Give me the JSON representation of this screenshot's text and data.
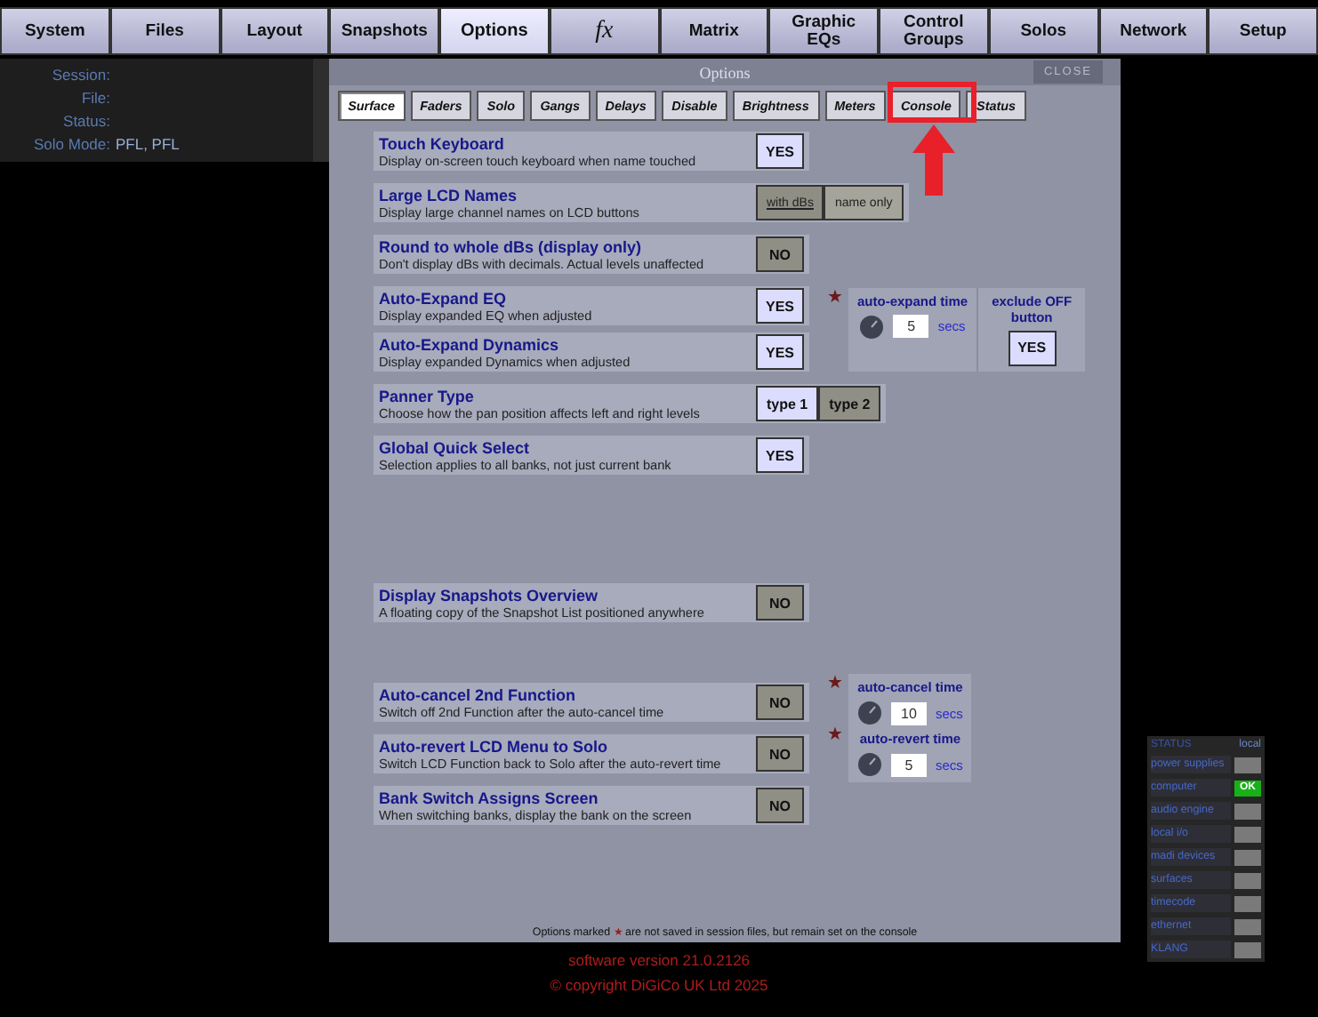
{
  "tabs": [
    {
      "label": "System",
      "kind": "text",
      "selected": false
    },
    {
      "label": "Files",
      "kind": "text",
      "selected": false
    },
    {
      "label": "Layout",
      "kind": "text",
      "selected": false
    },
    {
      "label": "Snapshots",
      "kind": "text",
      "selected": false
    },
    {
      "label": "Options",
      "kind": "text",
      "selected": true
    },
    {
      "label": "fx",
      "kind": "symbol",
      "selected": false
    },
    {
      "label": "Matrix",
      "kind": "text",
      "selected": false
    },
    {
      "label": "Graphic EQs",
      "kind": "text",
      "selected": false
    },
    {
      "label": "Control Groups",
      "kind": "text",
      "selected": false
    },
    {
      "label": "Solos",
      "kind": "text",
      "selected": false
    },
    {
      "label": "Network",
      "kind": "text",
      "selected": false
    },
    {
      "label": "Setup",
      "kind": "text",
      "selected": false
    }
  ],
  "info": [
    {
      "label": "Session:"
    },
    {
      "label": "File:"
    },
    {
      "label": "Status:"
    },
    {
      "label": "Solo Mode:",
      "value": "PFL, PFL"
    }
  ],
  "dialog": {
    "title": "Options",
    "close": "CLOSE",
    "tabs": [
      {
        "label": "Surface",
        "selected": true
      },
      {
        "label": "Faders",
        "selected": false
      },
      {
        "label": "Solo",
        "selected": false
      },
      {
        "label": "Gangs",
        "selected": false
      },
      {
        "label": "Delays",
        "selected": false
      },
      {
        "label": "Disable",
        "selected": false
      },
      {
        "label": "Brightness",
        "selected": false
      },
      {
        "label": "Meters",
        "selected": false
      },
      {
        "label": "Console",
        "selected": false
      },
      {
        "label": "Status",
        "selected": false
      }
    ],
    "blocks": [
      {
        "rows": [
          {
            "title": "Touch Keyboard",
            "description": "Display on-screen touch keyboard when name touched",
            "kind": "toggle",
            "value": "YES",
            "on": true
          }
        ]
      },
      {
        "rows": [
          {
            "title": "Large LCD Names",
            "description": "Display large channel names on LCD buttons",
            "kind": "choice",
            "disabled": true,
            "options": [
              {
                "label": "with dBs",
                "selected": true
              },
              {
                "label": "name only",
                "selected": false
              }
            ]
          }
        ]
      },
      {
        "rows": [
          {
            "title": "Round to whole dBs (display only)",
            "description": "Don't display dBs with decimals. Actual levels unaffected",
            "kind": "toggle",
            "value": "NO",
            "on": false
          }
        ]
      },
      {
        "rows": [
          {
            "title": "Auto-Expand EQ",
            "description": "Display expanded EQ when adjusted",
            "kind": "toggle",
            "value": "YES",
            "on": true
          },
          {
            "title": "Auto-Expand Dynamics",
            "description": "Display expanded Dynamics when adjusted",
            "kind": "toggle",
            "value": "YES",
            "on": true
          }
        ],
        "side": {
          "mark": "★",
          "title": "auto-expand time",
          "value": "5",
          "unit": "secs",
          "extra": {
            "title": "exclude OFF button",
            "value": "YES",
            "on": true
          }
        }
      },
      {
        "rows": [
          {
            "title": "Panner Type",
            "description": "Choose how the pan position affects left and right levels",
            "kind": "choice",
            "disabled": false,
            "options": [
              {
                "label": "type 1",
                "selected": true
              },
              {
                "label": "type 2",
                "selected": false
              }
            ]
          }
        ]
      },
      {
        "rows": [
          {
            "title": "Global Quick Select",
            "description": "Selection applies to all banks, not just current bank",
            "kind": "toggle",
            "value": "YES",
            "on": true
          }
        ]
      },
      {
        "rows": [
          {
            "title": "Display Snapshots Overview",
            "description": "A floating copy of the Snapshot List positioned anywhere",
            "kind": "toggle",
            "value": "NO",
            "on": false
          }
        ]
      },
      {
        "rows": [
          {
            "title": "Auto-cancel 2nd Function",
            "description": "Switch off 2nd Function after the auto-cancel time",
            "kind": "toggle",
            "value": "NO",
            "on": false
          }
        ],
        "side": {
          "mark": "★",
          "title": "auto-cancel time",
          "value": "10",
          "unit": "secs"
        }
      },
      {
        "rows": [
          {
            "title": "Auto-revert LCD Menu to Solo",
            "description": "Switch LCD Function back to Solo after the auto-revert time",
            "kind": "toggle",
            "value": "NO",
            "on": false
          }
        ],
        "side": {
          "mark": "★",
          "title": "auto-revert time",
          "value": "5",
          "unit": "secs"
        }
      },
      {
        "rows": [
          {
            "title": "Bank Switch Assigns Screen",
            "description": "When switching banks, display the bank on the screen",
            "kind": "toggle",
            "value": "NO",
            "on": false
          }
        ]
      }
    ],
    "footer_note": {
      "before": "Options marked",
      "mark": "★",
      "after": "are not saved in session files, but remain set on the console"
    }
  },
  "software_version": "software version 21.0.2126",
  "copyright": "© copyright DiGiCo UK Ltd 2025",
  "status_panel": {
    "title": "STATUS",
    "column": "local",
    "items": [
      {
        "label": "power supplies",
        "on": false
      },
      {
        "label": "computer",
        "on": true,
        "text": "OK"
      },
      {
        "label": "audio engine",
        "on": false
      },
      {
        "label": "local i/o",
        "on": false
      },
      {
        "label": "madi devices",
        "on": false
      },
      {
        "label": "surfaces",
        "on": false
      },
      {
        "label": "timecode",
        "on": false
      },
      {
        "label": "ethernet",
        "on": false
      },
      {
        "label": "KLANG",
        "on": false
      }
    ]
  }
}
